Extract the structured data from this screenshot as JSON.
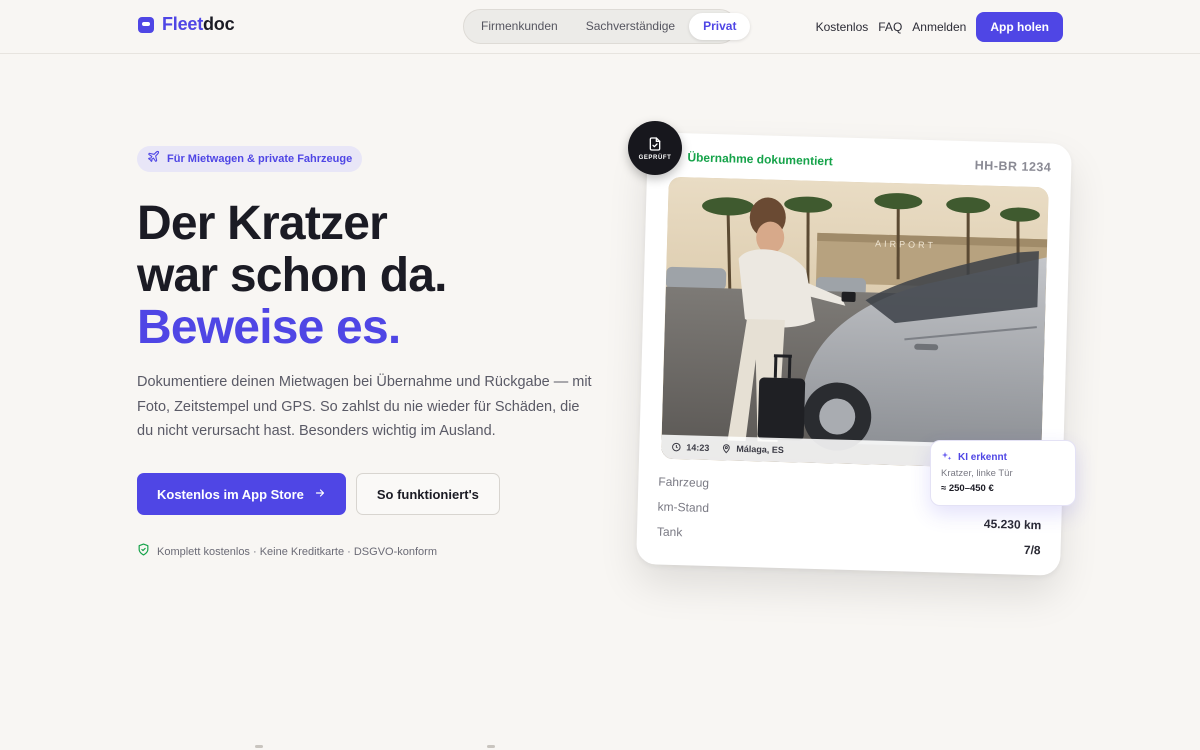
{
  "brand": {
    "name_part1": "Fleet",
    "name_part2": "doc",
    "accent_color": "#4f46e5"
  },
  "nav": {
    "segments": [
      {
        "label": "Firmenkunden",
        "active": false
      },
      {
        "label": "Sachverständige",
        "active": false
      },
      {
        "label": "Privat",
        "active": true
      }
    ],
    "links": [
      "Kostenlos",
      "FAQ",
      "Anmelden"
    ],
    "cta_label": "App holen"
  },
  "hero": {
    "badge": {
      "icon": "plane-icon",
      "text": "Für Mietwagen & private Fahrzeuge"
    },
    "headline": {
      "line1": "Der Kratzer",
      "line2": "war schon da.",
      "line3": "Beweise es."
    },
    "lede": "Dokumentiere deinen Mietwagen bei Übernahme und Rückgabe — mit Foto, Zeitstempel und GPS. So zahlst du nie wieder für Schäden, die du nicht verursacht hast. Besonders wichtig im Ausland.",
    "primary_cta": "Kostenlos im App Store",
    "secondary_cta": "So funktioniert's",
    "trust": {
      "icon": "shield-check-icon",
      "text": "Komplett kostenlos · Keine Kreditkarte · DSGVO-konform",
      "color": "#16a34a"
    }
  },
  "card": {
    "title": "Übernahme dokumentiert",
    "title_color": "#16a34a",
    "plate": "HH-BR 1234",
    "stamp_label": "GEPRÜFT",
    "photo": {
      "time": "14:23",
      "location": "Málaga, ES",
      "sign_text": "AIRPORT"
    },
    "rows": [
      {
        "label": "Fahrzeug",
        "value": ""
      },
      {
        "label": "km-Stand",
        "value": "45.230 km"
      },
      {
        "label": "Tank",
        "value": "7/8"
      }
    ],
    "ai": {
      "title": "KI erkennt",
      "finding": "Kratzer, linke Tür",
      "price": "≈ 250–450 €"
    }
  }
}
